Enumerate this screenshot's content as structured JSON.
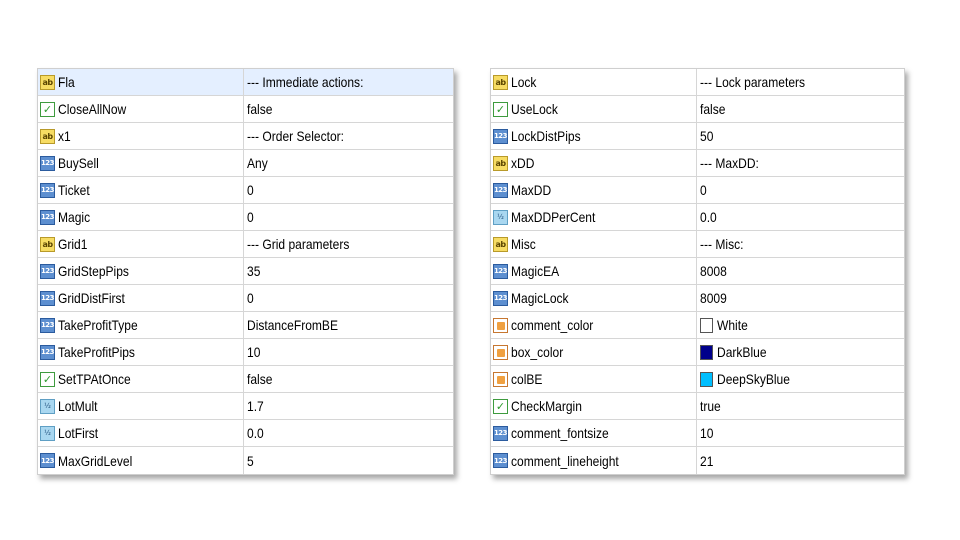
{
  "left_panel": {
    "rows": [
      {
        "name": "Fla",
        "value": "--- Immediate actions:",
        "type": "string"
      },
      {
        "name": "CloseAllNow",
        "value": "false",
        "type": "bool"
      },
      {
        "name": "x1",
        "value": "--- Order Selector:",
        "type": "string"
      },
      {
        "name": "BuySell",
        "value": "Any",
        "type": "int"
      },
      {
        "name": "Ticket",
        "value": "0",
        "type": "int"
      },
      {
        "name": "Magic",
        "value": "0",
        "type": "int"
      },
      {
        "name": "Grid1",
        "value": "--- Grid parameters",
        "type": "string"
      },
      {
        "name": "GridStepPips",
        "value": "35",
        "type": "int"
      },
      {
        "name": "GridDistFirst",
        "value": "0",
        "type": "int"
      },
      {
        "name": "TakeProfitType",
        "value": "DistanceFromBE",
        "type": "int"
      },
      {
        "name": "TakeProfitPips",
        "value": "10",
        "type": "int"
      },
      {
        "name": "SetTPAtOnce",
        "value": "false",
        "type": "bool"
      },
      {
        "name": "LotMult",
        "value": "1.7",
        "type": "double"
      },
      {
        "name": "LotFirst",
        "value": "0.0",
        "type": "double"
      },
      {
        "name": "MaxGridLevel",
        "value": "5",
        "type": "int"
      }
    ]
  },
  "right_panel": {
    "rows": [
      {
        "name": "Lock",
        "value": "--- Lock parameters",
        "type": "string"
      },
      {
        "name": "UseLock",
        "value": "false",
        "type": "bool"
      },
      {
        "name": "LockDistPips",
        "value": "50",
        "type": "int"
      },
      {
        "name": "xDD",
        "value": "--- MaxDD:",
        "type": "string"
      },
      {
        "name": "MaxDD",
        "value": "0",
        "type": "int"
      },
      {
        "name": "MaxDDPerCent",
        "value": "0.0",
        "type": "double"
      },
      {
        "name": "Misc",
        "value": "--- Misc:",
        "type": "string"
      },
      {
        "name": "MagicEA",
        "value": "8008",
        "type": "int"
      },
      {
        "name": "MagicLock",
        "value": "8009",
        "type": "int"
      },
      {
        "name": "comment_color",
        "value": "White",
        "type": "color",
        "swatch": "#ffffff"
      },
      {
        "name": "box_color",
        "value": "DarkBlue",
        "type": "color",
        "swatch": "#00008b"
      },
      {
        "name": "colBE",
        "value": "DeepSkyBlue",
        "type": "color",
        "swatch": "#00bfff"
      },
      {
        "name": "CheckMargin",
        "value": "true",
        "type": "bool"
      },
      {
        "name": "comment_fontsize",
        "value": "10",
        "type": "int"
      },
      {
        "name": "comment_lineheight",
        "value": "21",
        "type": "int"
      }
    ]
  },
  "icons": {
    "string": {
      "name": "string-type-icon",
      "glyph": "ab"
    },
    "int": {
      "name": "integer-type-icon",
      "glyph": "123"
    },
    "double": {
      "name": "double-type-icon",
      "glyph": "½"
    },
    "bool": {
      "name": "boolean-type-icon",
      "glyph": "✓"
    },
    "color": {
      "name": "color-type-icon",
      "glyph": ""
    }
  },
  "colors": {
    "selected_row": "#e4efff",
    "grid_line": "#d6d6d6"
  }
}
